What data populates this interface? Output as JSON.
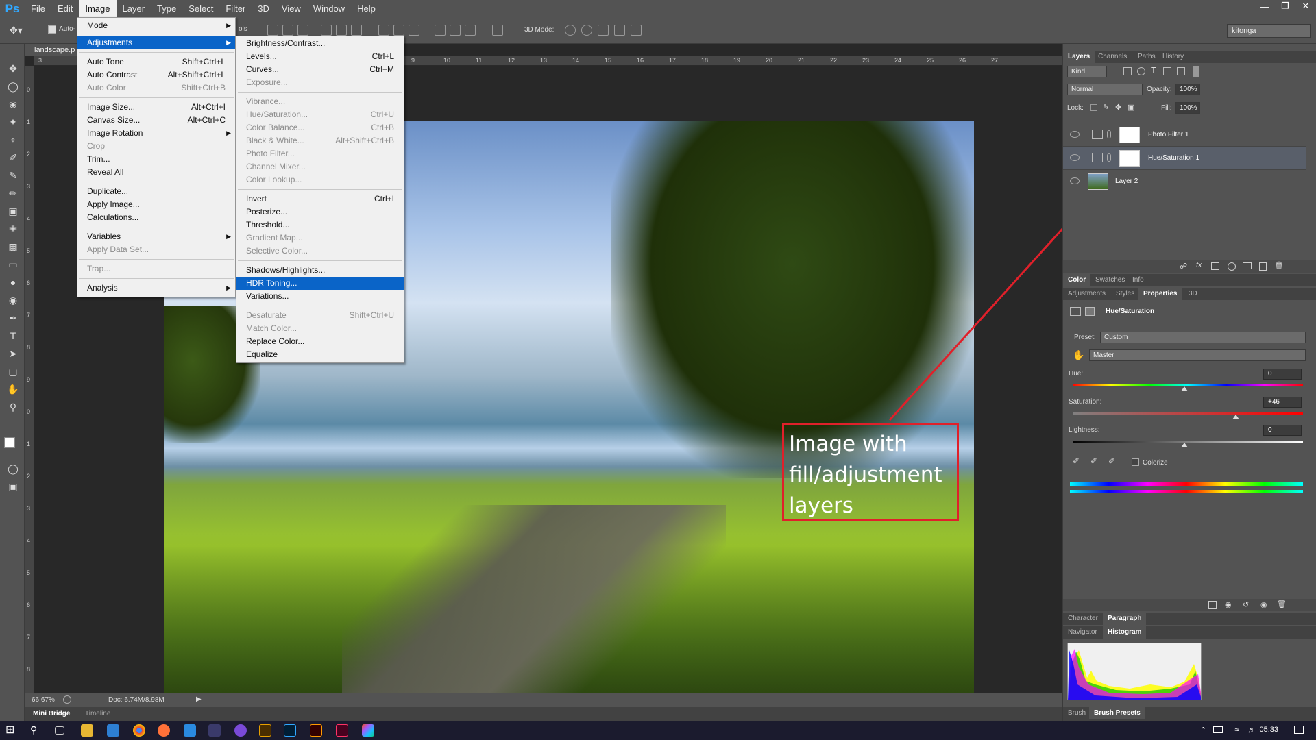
{
  "app": {
    "logo": "Ps"
  },
  "menubar": {
    "items": [
      "File",
      "Edit",
      "Image",
      "Layer",
      "Type",
      "Select",
      "Filter",
      "3D",
      "View",
      "Window",
      "Help"
    ],
    "active": "Image"
  },
  "options": {
    "auto_label": "Auto-",
    "tools_label": "ols",
    "mode3d_label": "3D Mode:",
    "workspace": "kitonga"
  },
  "document": {
    "tab_title": "landscape.p"
  },
  "ruler": {
    "h_ticks": [
      "3",
      "9",
      "10",
      "11",
      "12",
      "13",
      "14",
      "15",
      "16",
      "17",
      "18",
      "19",
      "20",
      "21",
      "22",
      "23",
      "24",
      "25",
      "26",
      "27"
    ],
    "v_ticks": [
      "0",
      "1",
      "2",
      "3",
      "4",
      "5",
      "6",
      "7",
      "8",
      "9",
      "0",
      "1",
      "2",
      "3",
      "4",
      "5",
      "6",
      "7",
      "8"
    ]
  },
  "annotation": {
    "line1": "Image with",
    "line2": "fill/adjustment",
    "line3": "layers"
  },
  "status": {
    "zoom": "66.67%",
    "doc": "Doc: 6.74M/8.98M"
  },
  "bottom_tabs": {
    "mini_bridge": "Mini Bridge",
    "timeline": "Timeline"
  },
  "image_menu": {
    "mode": "Mode",
    "adjustments": "Adjustments",
    "auto_tone": "Auto Tone",
    "auto_tone_sc": "Shift+Ctrl+L",
    "auto_contrast": "Auto Contrast",
    "auto_contrast_sc": "Alt+Shift+Ctrl+L",
    "auto_color": "Auto Color",
    "auto_color_sc": "Shift+Ctrl+B",
    "image_size": "Image Size...",
    "image_size_sc": "Alt+Ctrl+I",
    "canvas_size": "Canvas Size...",
    "canvas_size_sc": "Alt+Ctrl+C",
    "image_rotation": "Image Rotation",
    "crop": "Crop",
    "trim": "Trim...",
    "reveal_all": "Reveal All",
    "duplicate": "Duplicate...",
    "apply_image": "Apply Image...",
    "calculations": "Calculations...",
    "variables": "Variables",
    "apply_data_set": "Apply Data Set...",
    "trap": "Trap...",
    "analysis": "Analysis"
  },
  "adjustments_menu": {
    "brightness": "Brightness/Contrast...",
    "levels": "Levels...",
    "levels_sc": "Ctrl+L",
    "curves": "Curves...",
    "curves_sc": "Ctrl+M",
    "exposure": "Exposure...",
    "vibrance": "Vibrance...",
    "hue_sat": "Hue/Saturation...",
    "hue_sat_sc": "Ctrl+U",
    "color_balance": "Color Balance...",
    "color_balance_sc": "Ctrl+B",
    "black_white": "Black & White...",
    "black_white_sc": "Alt+Shift+Ctrl+B",
    "photo_filter": "Photo Filter...",
    "channel_mixer": "Channel Mixer...",
    "color_lookup": "Color Lookup...",
    "invert": "Invert",
    "invert_sc": "Ctrl+I",
    "posterize": "Posterize...",
    "threshold": "Threshold...",
    "gradient_map": "Gradient Map...",
    "selective_color": "Selective Color...",
    "shadows_highlights": "Shadows/Highlights...",
    "hdr_toning": "HDR Toning...",
    "variations": "Variations...",
    "desaturate": "Desaturate",
    "desaturate_sc": "Shift+Ctrl+U",
    "match_color": "Match Color...",
    "replace_color": "Replace Color...",
    "equalize": "Equalize"
  },
  "layers_panel": {
    "tabs": [
      "Layers",
      "Channels",
      "Paths",
      "History"
    ],
    "kind": "Kind",
    "blend_mode": "Normal",
    "opacity_label": "Opacity:",
    "opacity": "100%",
    "lock_label": "Lock:",
    "fill_label": "Fill:",
    "fill": "100%",
    "layers": [
      {
        "name": "Photo Filter 1"
      },
      {
        "name": "Hue/Saturation 1"
      },
      {
        "name": "Layer 2"
      }
    ]
  },
  "color_tabs": [
    "Color",
    "Swatches",
    "Info"
  ],
  "props_tabs": [
    "Adjustments",
    "Styles",
    "Properties",
    "3D"
  ],
  "properties": {
    "title": "Hue/Saturation",
    "preset_label": "Preset:",
    "preset": "Custom",
    "channel": "Master",
    "hue_label": "Hue:",
    "hue": "0",
    "saturation_label": "Saturation:",
    "saturation": "+46",
    "lightness_label": "Lightness:",
    "lightness": "0",
    "colorize": "Colorize"
  },
  "char_tabs": [
    "Character",
    "Paragraph"
  ],
  "nav_tabs": [
    "Navigator",
    "Histogram"
  ],
  "brush_tabs": [
    "Brush",
    "Brush Presets"
  ],
  "taskbar": {
    "time": "05:33"
  },
  "colors": {
    "highlight": "#0a64c8",
    "annotation": "#e0202a",
    "ps_blue": "#31a8ff"
  }
}
